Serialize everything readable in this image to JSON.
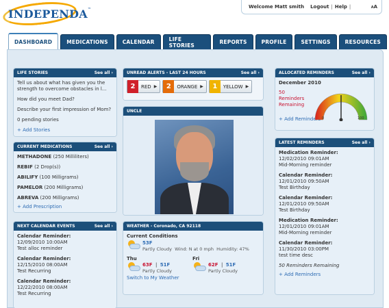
{
  "logo": {
    "text": "INDEPENDA"
  },
  "userbar": {
    "welcome": "Welcome Matt smith",
    "logout": "Logout",
    "help": "Help",
    "aa": "AA"
  },
  "tabs": [
    {
      "label": "DASHBOARD",
      "active": true
    },
    {
      "label": "MEDICATIONS"
    },
    {
      "label": "CALENDAR"
    },
    {
      "label": "LIFE STORIES"
    },
    {
      "label": "REPORTS"
    },
    {
      "label": "PROFILE"
    },
    {
      "label": "SETTINGS"
    },
    {
      "label": "RESOURCES"
    }
  ],
  "see_all": "See all",
  "life_stories": {
    "title": "LIFE STORIES",
    "items": [
      "Tell us about what has given you the strength to overcome obstacles in l...",
      "How did you meet Dad?",
      "Describe your first impression of Mom?"
    ],
    "pending": "0 pending stories",
    "add": "+ Add Stories"
  },
  "medications": {
    "title": "CURRENT MEDICATIONS",
    "items": [
      {
        "name": "METHADONE",
        "dose": "(250 Milliliters)"
      },
      {
        "name": "REBIF",
        "dose": "(2 Drop(s))"
      },
      {
        "name": "ABILIFY",
        "dose": "(100 Milligrams)"
      },
      {
        "name": "PAMELOR",
        "dose": "(200 Milligrams)"
      },
      {
        "name": "ABREVA",
        "dose": "(200 Milligrams)"
      }
    ],
    "add": "+ Add Prescription"
  },
  "calendar": {
    "title": "NEXT CALENDAR EVENTS",
    "items": [
      {
        "type": "Calendar Reminder:",
        "date": "12/09/2010 10:00AM",
        "desc": "Test alloc reminder"
      },
      {
        "type": "Calendar Reminder:",
        "date": "12/15/2010 08:00AM",
        "desc": "Test Recurring"
      },
      {
        "type": "Calendar Reminder:",
        "date": "12/22/2010 08:00AM",
        "desc": "Test Recurring"
      }
    ]
  },
  "alerts": {
    "title": "UNREAD ALERTS - LAST 24 HOURS",
    "items": [
      {
        "count": "2",
        "label": "RED",
        "color": "#d0202a"
      },
      {
        "count": "2",
        "label": "ORANGE",
        "color": "#e46c0a"
      },
      {
        "count": "1",
        "label": "YELLOW",
        "color": "#f0b400"
      }
    ]
  },
  "uncle": {
    "title": "UNCLE"
  },
  "weather": {
    "title": "WEATHER - Coronado, CA  92118",
    "current_label": "Current Conditions",
    "current_temp": "53F",
    "current_desc": "Partly Cloudy",
    "wind": "Wind: N at 0 mph",
    "humidity": "Humidity: 47%",
    "days": [
      {
        "day": "Thu",
        "hi": "63F",
        "lo": "51F",
        "desc": "Partly Cloudy"
      },
      {
        "day": "Fri",
        "hi": "62F",
        "lo": "51F",
        "desc": "Partly Cloudy"
      }
    ],
    "switch": "Switch to My Weather"
  },
  "allocated": {
    "title": "ALLOCATED REMINDERS",
    "month": "December 2010",
    "count": "50",
    "line1": "Reminders",
    "line2": "Remaining",
    "gauge_min": "0",
    "gauge_max": "100",
    "add": "+ Add Reminders"
  },
  "latest": {
    "title": "LATEST REMINDERS",
    "items": [
      {
        "type": "Medication Reminder:",
        "date": "12/02/2010 09:01AM",
        "desc": "Mid-Morning reminder"
      },
      {
        "type": "Calendar Reminder:",
        "date": "12/01/2010 09:50AM",
        "desc": "Test Birthday"
      },
      {
        "type": "Calendar Reminder:",
        "date": "12/01/2010 09:50AM",
        "desc": "Test Birthday"
      },
      {
        "type": "Medication Reminder:",
        "date": "12/01/2010 09:01AM",
        "desc": "Mid-Morning reminder"
      },
      {
        "type": "Calendar Reminder:",
        "date": "11/30/2010 03:00PM",
        "desc": "test time desc"
      }
    ],
    "remaining": "50 Reminders Remaining",
    "add": "+ Add Reminders"
  }
}
